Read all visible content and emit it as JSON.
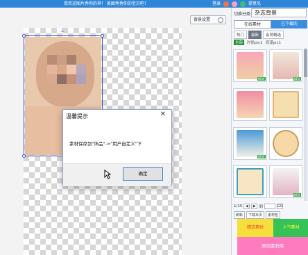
{
  "banner": {
    "promo": "受欢迎图片秀你的神！ 美图秀秀你的宝贝吧！",
    "login": "登录",
    "user": "用户",
    "feedback": "提意见",
    "share": "分享"
  },
  "canvas": {
    "bg_settings_label": "背景设置"
  },
  "dialog": {
    "title": "温馨提示",
    "message": "素材保存到\"饰品\"->\"用户自定义\"下",
    "ok_label": "确定"
  },
  "panel": {
    "category_label": "切换分类",
    "category_value": "杂志背景",
    "tabs": [
      "在线素材",
      "已下载的"
    ],
    "subtabs": [
      "热门",
      "最新",
      "会员精选"
    ],
    "filters": [
      "全部",
      "时尚pic1",
      "浪漫pic1"
    ],
    "pager_text": "1/15",
    "pager_jump_label": "到",
    "pager_go": "GO",
    "tools": [
      "刷新",
      "下载本页",
      "素材包"
    ],
    "ads": [
      "精选素材",
      "人气素材",
      "原创素材库"
    ],
    "new_badge": "NEW"
  }
}
